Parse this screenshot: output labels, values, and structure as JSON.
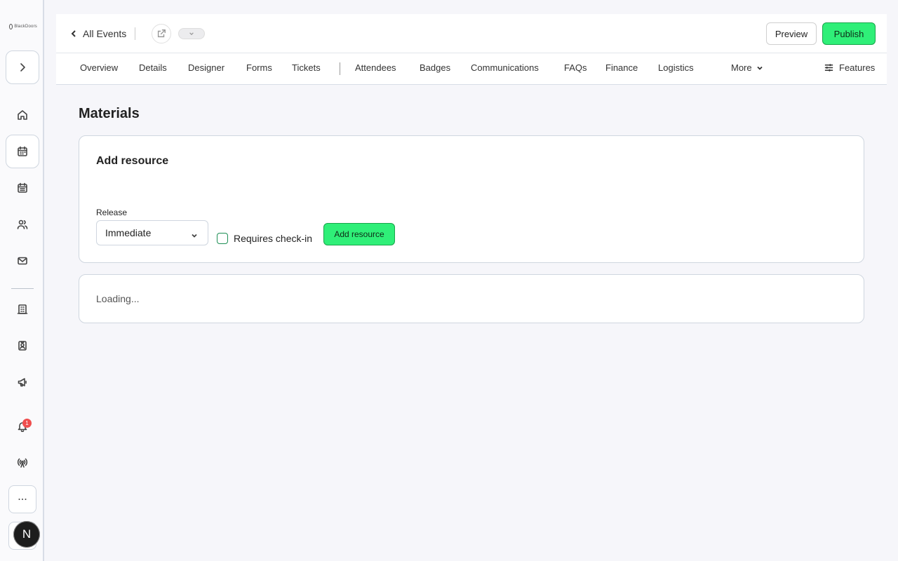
{
  "app": {
    "logo_text": "BlackDoors"
  },
  "sidebar": {
    "notification_count": "1",
    "avatar_initial": "N"
  },
  "header": {
    "back_label": "All Events",
    "preview_label": "Preview",
    "publish_label": "Publish",
    "accent_color": "#2fef78"
  },
  "tabs": [
    {
      "label": "Overview"
    },
    {
      "label": "Details"
    },
    {
      "label": "Designer"
    },
    {
      "label": "Forms"
    },
    {
      "label": "Tickets"
    },
    {
      "label": "Attendees"
    },
    {
      "label": "Badges"
    },
    {
      "label": "Communications"
    },
    {
      "label": "FAQs"
    },
    {
      "label": "Finance"
    },
    {
      "label": "Logistics"
    }
  ],
  "tabs_more_label": "More",
  "features_label": "Features",
  "main": {
    "page_title": "Materials",
    "card_title": "Add resource",
    "release_label": "Release",
    "release_value": "Immediate",
    "requires_checkin_label": "Requires check-in",
    "add_button_label": "Add resource",
    "loading_text": "Loading..."
  }
}
